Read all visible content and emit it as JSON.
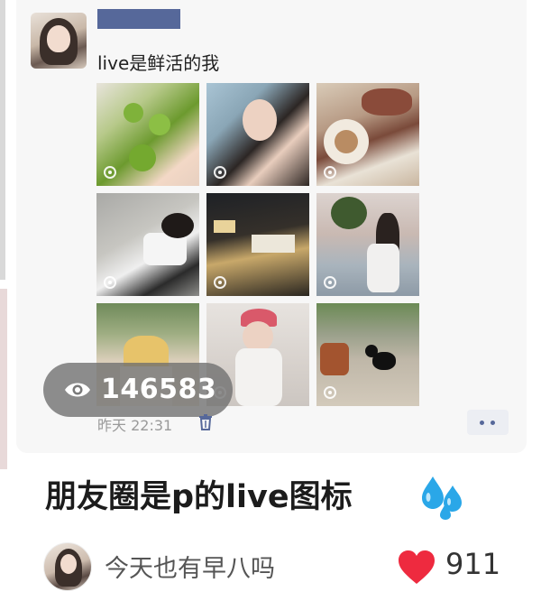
{
  "post": {
    "caption": "live是鲜活的我",
    "time": "昨天 22:31",
    "views": "146583",
    "photos": [
      {
        "subject": "hand holding green limes",
        "has_live_badge": true
      },
      {
        "subject": "girl with long dark hair",
        "has_live_badge": true
      },
      {
        "subject": "steak and latte on table",
        "has_live_badge": true
      },
      {
        "subject": "girl lying on street",
        "has_live_badge": true
      },
      {
        "subject": "night street signs",
        "has_live_badge": true
      },
      {
        "subject": "girl by the sea with palm",
        "has_live_badge": true
      },
      {
        "subject": "dessert cup outdoors",
        "has_live_badge": false
      },
      {
        "subject": "girl in red cap mirror selfie",
        "has_live_badge": true
      },
      {
        "subject": "black cat on stone path",
        "has_live_badge": true
      }
    ]
  },
  "note": {
    "title": "朋友圈是p的live图标"
  },
  "author": {
    "name": "今天也有早八吗"
  },
  "likes": {
    "count": "911"
  },
  "colors": {
    "wechat_name_blue": "#56689a",
    "heart_red": "#ee2a3f",
    "drops_blue": "#2aa7e8"
  },
  "icons": [
    "eye-icon",
    "trash-icon",
    "more-dots-icon",
    "live-photo-icon",
    "sweat-drops-icon",
    "heart-icon"
  ]
}
